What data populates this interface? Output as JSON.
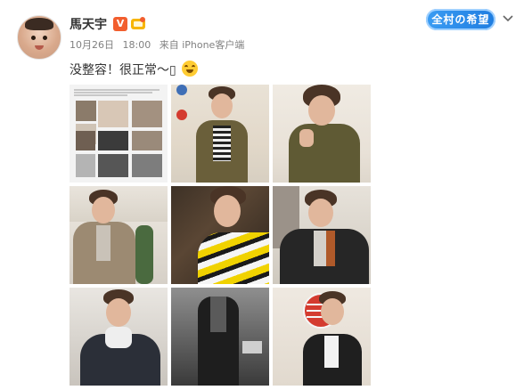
{
  "post": {
    "username": "馬天宇",
    "verified_badge": "V",
    "date": "10月26日",
    "time": "18:00",
    "source": "来自 iPhone客户端",
    "text": "没整容！很正常～▯",
    "emoji_icon": "laughing-tears-emoji-icon"
  },
  "header": {
    "brand_badge_text": "全村の希望",
    "menu_icon": "chevron-down-icon"
  },
  "photos": [
    {
      "name": "collage-thumbnail",
      "kind": "photo"
    },
    {
      "name": "olive-jacket-photo",
      "kind": "photo"
    },
    {
      "name": "olive-jacket-closeup-photo",
      "kind": "photo"
    },
    {
      "name": "beige-blazer-photo",
      "kind": "photo"
    },
    {
      "name": "striped-sweater-photo",
      "kind": "photo"
    },
    {
      "name": "leather-jacket-photo",
      "kind": "photo"
    },
    {
      "name": "turtleneck-photo",
      "kind": "photo"
    },
    {
      "name": "black-coat-photo",
      "kind": "photo"
    },
    {
      "name": "street-sign-photo",
      "kind": "photo"
    }
  ],
  "colors": {
    "vip_orange": "#f25e2e",
    "brand_blue": "#1f7de0",
    "meta_gray": "#808080"
  }
}
